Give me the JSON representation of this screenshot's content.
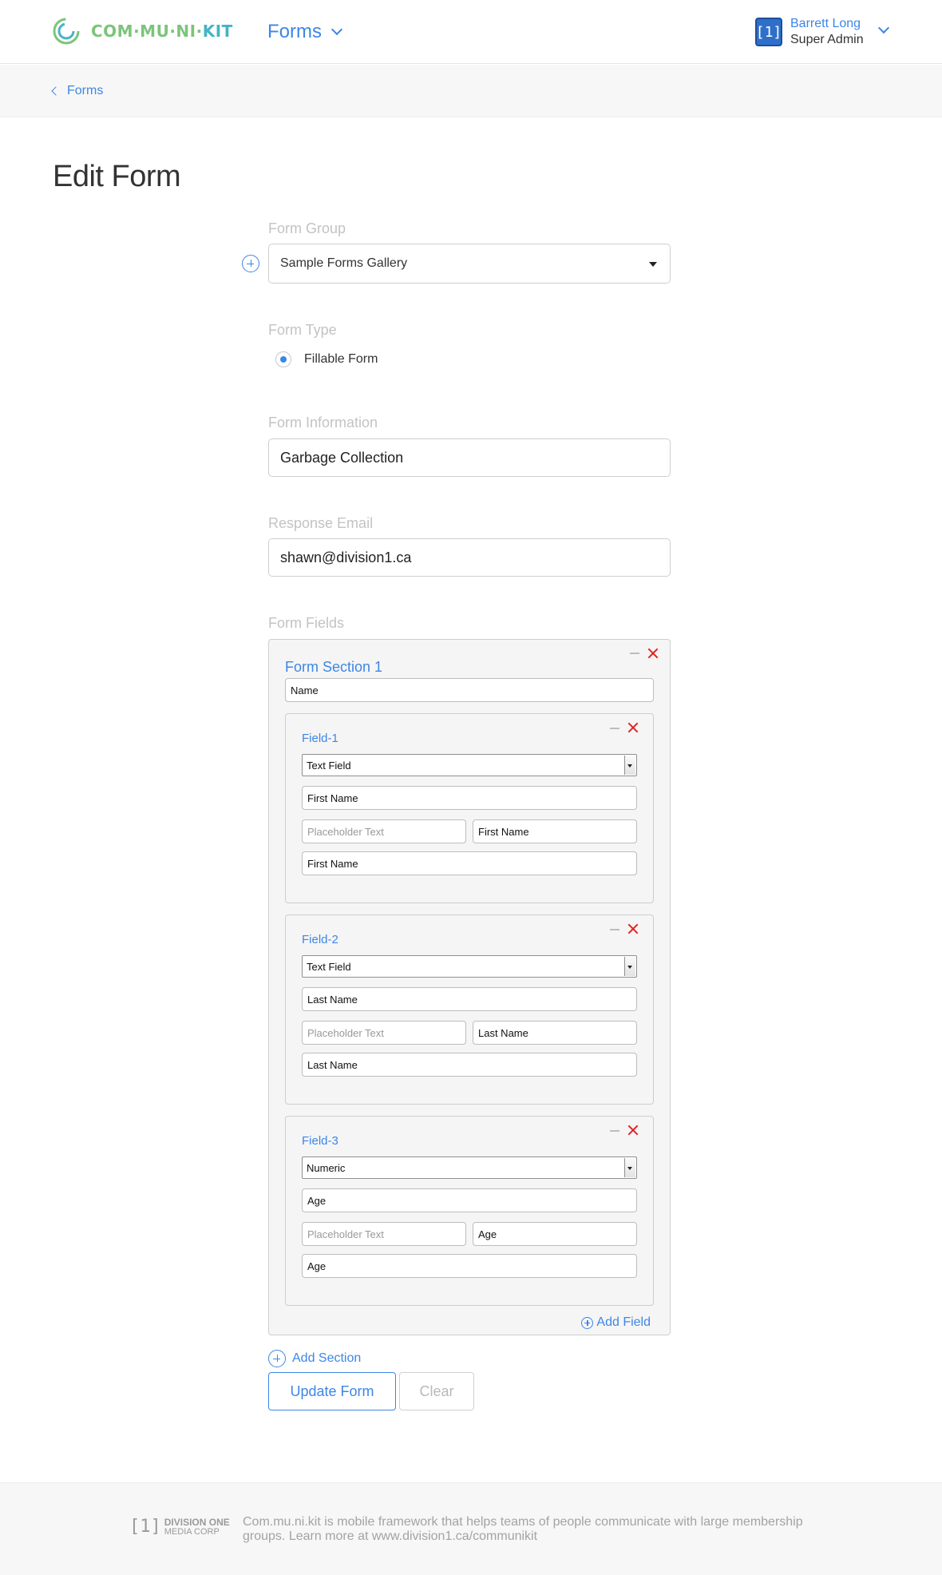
{
  "header": {
    "logo_text_a": "COM·MU·NI·",
    "logo_text_b": "KIT",
    "nav_label": "Forms",
    "user": {
      "name": "Barrett Long",
      "role": "Super Admin",
      "avatar_text": "[1]"
    }
  },
  "breadcrumb": {
    "label": "Forms"
  },
  "page": {
    "title": "Edit Form"
  },
  "form": {
    "group": {
      "label": "Form Group",
      "value": "Sample Forms Gallery"
    },
    "type": {
      "label": "Form Type",
      "option": "Fillable Form"
    },
    "info": {
      "label": "Form Information",
      "value": "Garbage Collection"
    },
    "email": {
      "label": "Response Email",
      "value": "shawn@division1.ca"
    },
    "fields_label": "Form Fields",
    "section": {
      "title": "Form Section 1",
      "name_value": "Name",
      "fields": [
        {
          "title": "Field-1",
          "type": "Text Field",
          "label": "First Name",
          "placeholder_hint": "Placeholder Text",
          "placeholder_value": "First Name",
          "key": "First Name"
        },
        {
          "title": "Field-2",
          "type": "Text Field",
          "label": "Last Name",
          "placeholder_hint": "Placeholder Text",
          "placeholder_value": "Last Name",
          "key": "Last Name"
        },
        {
          "title": "Field-3",
          "type": "Numeric",
          "label": "Age",
          "placeholder_hint": "Placeholder Text",
          "placeholder_value": "Age",
          "key": "Age"
        }
      ],
      "add_field_label": "Add Field"
    },
    "add_section_label": "Add Section",
    "update_label": "Update Form",
    "clear_label": "Clear"
  },
  "footer": {
    "logo_line1": "DIVISION ONE",
    "logo_line2": "MEDIA CORP",
    "logo_mark": "[1]",
    "text": "Com.mu.ni.kit is mobile framework that helps teams of people communicate with large membership groups. Learn more at www.division1.ca/communikit"
  },
  "colors": {
    "accent": "#3d86e6",
    "logo_green": "#7cc47a",
    "logo_teal": "#46b3c5",
    "danger": "#e02424"
  }
}
